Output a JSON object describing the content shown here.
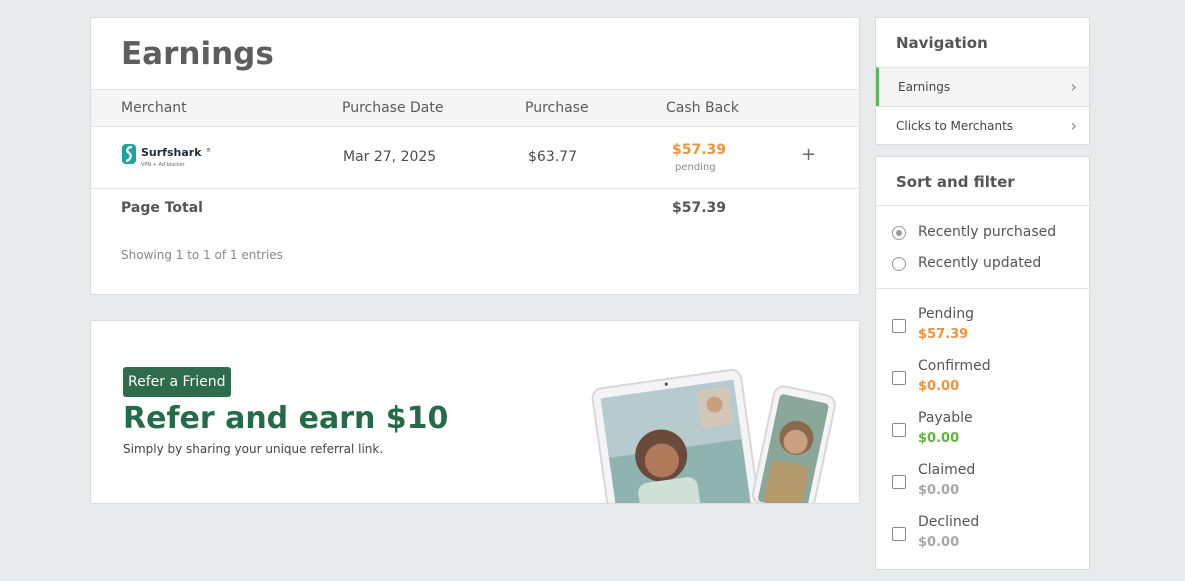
{
  "earnings": {
    "title": "Earnings",
    "columns": [
      "Merchant",
      "Purchase Date",
      "Purchase",
      "Cash Back"
    ],
    "rows": [
      {
        "merchant": "Surfshark",
        "merchant_tagline": "VPN + Ad blocker",
        "merchant_icon": "surfshark-logo",
        "purchase_date": "Mar 27, 2025",
        "purchase": "$63.77",
        "cash_back": "$57.39",
        "status": "pending",
        "expand": "+"
      }
    ],
    "page_total_label": "Page Total",
    "page_total_value": "$57.39",
    "showing": "Showing 1 to 1 of 1 entries"
  },
  "referral": {
    "badge": "Refer a Friend",
    "title": "Refer and earn $10",
    "subtitle": "Simply by sharing your unique referral link."
  },
  "navigation": {
    "title": "Navigation",
    "items": [
      {
        "label": "Earnings",
        "active": true
      },
      {
        "label": "Clicks to Merchants",
        "active": false
      }
    ],
    "chevron": "›"
  },
  "sort_filter": {
    "title": "Sort and filter",
    "sort_options": [
      {
        "label": "Recently purchased",
        "selected": true
      },
      {
        "label": "Recently updated",
        "selected": false
      }
    ],
    "filters": [
      {
        "label": "Pending",
        "amount": "$57.39",
        "color": "#f0933b"
      },
      {
        "label": "Confirmed",
        "amount": "$0.00",
        "color": "#f0933b"
      },
      {
        "label": "Payable",
        "amount": "$0.00",
        "color": "#5fb53f"
      },
      {
        "label": "Claimed",
        "amount": "$0.00",
        "color": "#a8a8a8"
      },
      {
        "label": "Declined",
        "amount": "$0.00",
        "color": "#a8a8a8"
      }
    ]
  },
  "colors": {
    "accent_green": "#256b49",
    "pending_orange": "#f0933b",
    "active_nav_bar": "#5cb85c"
  }
}
